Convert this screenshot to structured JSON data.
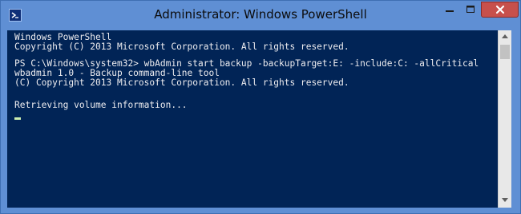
{
  "window": {
    "title": "Administrator: Windows PowerShell",
    "controls": {
      "minimize": "minimize",
      "maximize": "maximize",
      "close": "close"
    }
  },
  "console": {
    "lines": [
      "Windows PowerShell",
      "Copyright (C) 2013 Microsoft Corporation. All rights reserved.",
      "",
      "PS C:\\Windows\\system32> wbAdmin start backup -backupTarget:E: -include:C: -allCritical",
      "wbadmin 1.0 - Backup command-line tool",
      "(C) Copyright 2013 Microsoft Corporation. All rights reserved.",
      "",
      "Retrieving volume information..."
    ]
  },
  "icons": {
    "app": "powershell-icon",
    "minimize": "minimize-icon",
    "maximize": "maximize-icon",
    "close": "close-icon",
    "scroll_up": "scroll-up-icon",
    "scroll_down": "scroll-down-icon"
  },
  "colors": {
    "frame": "#5f8fd4",
    "console_bg": "#012456",
    "console_text": "#eeedf0",
    "close_button": "#c7504c"
  }
}
